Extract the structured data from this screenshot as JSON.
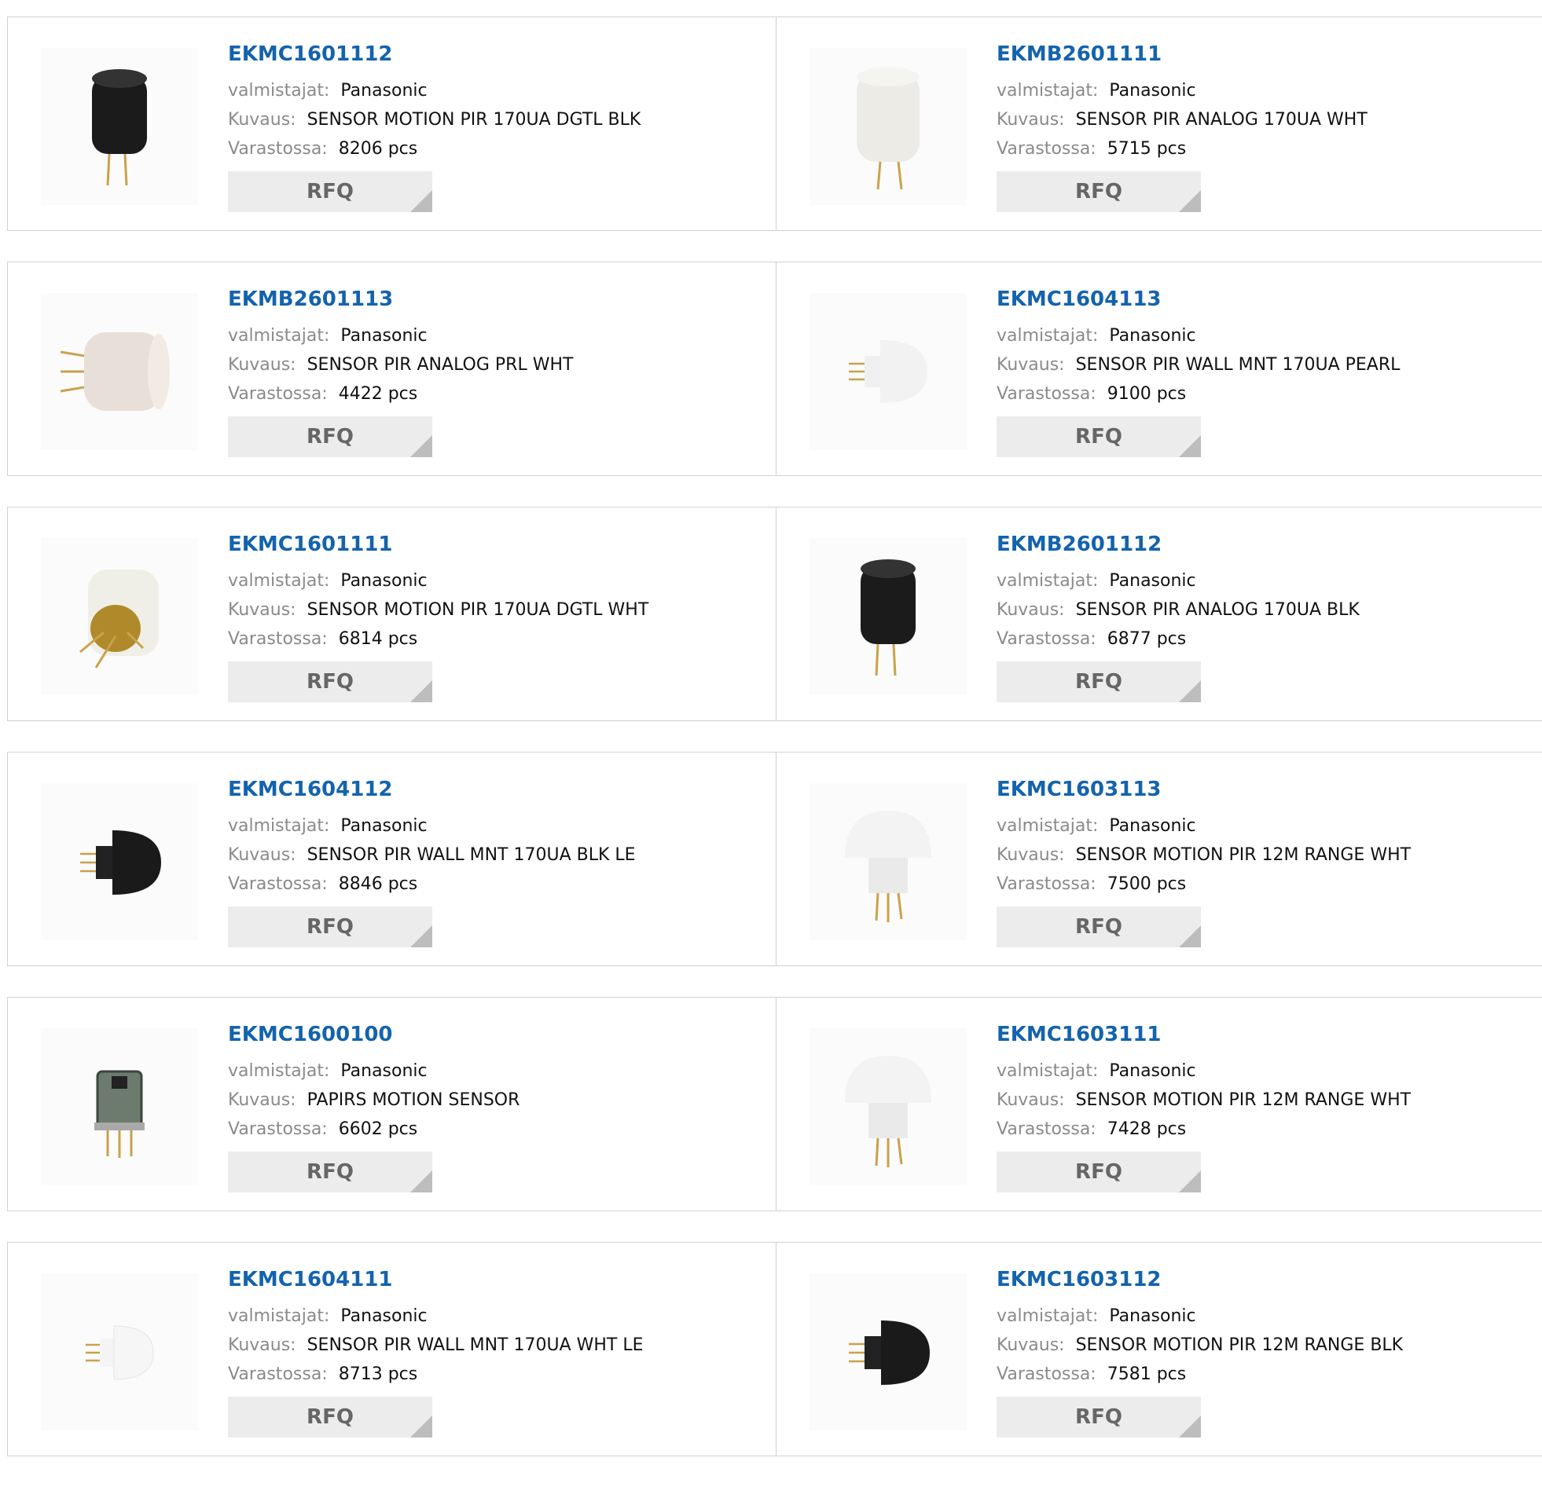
{
  "labels": {
    "manufacturer": "valmistajat:",
    "description": "Kuvaus:",
    "stock": "Varastossa:",
    "rfq": "RFQ"
  },
  "products": [
    {
      "part": "EKMC1601112",
      "manufacturer": "Panasonic",
      "description": "SENSOR MOTION PIR 170UA DGTL BLK",
      "stock": "8206 pcs",
      "image": "black-cylinder-sensor"
    },
    {
      "part": "EKMB2601111",
      "manufacturer": "Panasonic",
      "description": "SENSOR PIR ANALOG 170UA WHT",
      "stock": "5715 pcs",
      "image": "white-cylinder-sensor"
    },
    {
      "part": "EKMB2601113",
      "manufacturer": "Panasonic",
      "description": "SENSOR PIR ANALOG PRL WHT",
      "stock": "4422 pcs",
      "image": "pearl-cylinder-sensor"
    },
    {
      "part": "EKMC1604113",
      "manufacturer": "Panasonic",
      "description": "SENSOR PIR WALL MNT 170UA PEARL",
      "stock": "9100 pcs",
      "image": "pearl-dome-sensor"
    },
    {
      "part": "EKMC1601111",
      "manufacturer": "Panasonic",
      "description": "SENSOR MOTION PIR 170UA DGTL WHT",
      "stock": "6814 pcs",
      "image": "white-cylinder-gold-base-sensor"
    },
    {
      "part": "EKMB2601112",
      "manufacturer": "Panasonic",
      "description": "SENSOR PIR ANALOG 170UA BLK",
      "stock": "6877 pcs",
      "image": "black-cylinder-sensor"
    },
    {
      "part": "EKMC1604112",
      "manufacturer": "Panasonic",
      "description": "SENSOR PIR WALL MNT 170UA BLK LE",
      "stock": "8846 pcs",
      "image": "black-dome-sensor"
    },
    {
      "part": "EKMC1603113",
      "manufacturer": "Panasonic",
      "description": "SENSOR MOTION PIR 12M RANGE WHT",
      "stock": "7500 pcs",
      "image": "white-dome-sensor"
    },
    {
      "part": "EKMC1600100",
      "manufacturer": "Panasonic",
      "description": "PAPIRS MOTION SENSOR",
      "stock": "6602 pcs",
      "image": "metal-can-sensor"
    },
    {
      "part": "EKMC1603111",
      "manufacturer": "Panasonic",
      "description": "SENSOR MOTION PIR 12M RANGE WHT",
      "stock": "7428 pcs",
      "image": "white-dome-sensor"
    },
    {
      "part": "EKMC1604111",
      "manufacturer": "Panasonic",
      "description": "SENSOR PIR WALL MNT 170UA WHT LE",
      "stock": "8713 pcs",
      "image": "white-small-dome-sensor"
    },
    {
      "part": "EKMC1603112",
      "manufacturer": "Panasonic",
      "description": "SENSOR MOTION PIR 12M RANGE BLK",
      "stock": "7581 pcs",
      "image": "black-dome-sensor"
    }
  ],
  "colors": {
    "link": "#1463ad",
    "label": "#8a8a8a",
    "button_bg": "#ececec",
    "button_text": "#666666",
    "border": "#d2d2d2"
  }
}
